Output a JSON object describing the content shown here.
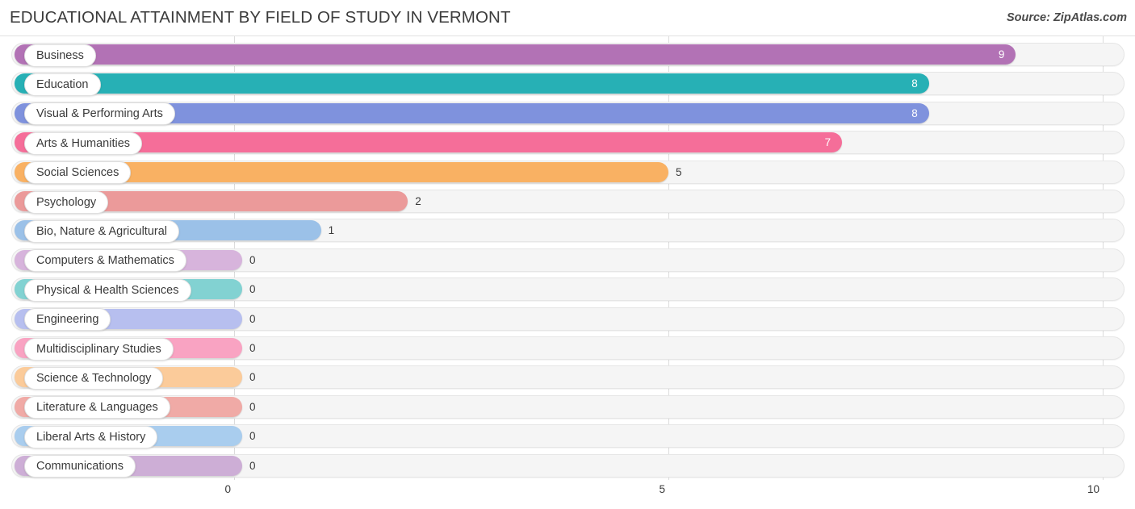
{
  "header": {
    "title": "EDUCATIONAL ATTAINMENT BY FIELD OF STUDY IN VERMONT",
    "source": "Source: ZipAtlas.com"
  },
  "chart_data": {
    "type": "bar",
    "orientation": "horizontal",
    "title": "EDUCATIONAL ATTAINMENT BY FIELD OF STUDY IN VERMONT",
    "xlabel": "",
    "ylabel": "",
    "xlim": [
      0,
      10
    ],
    "grid": true,
    "legend": "none",
    "xticks": [
      "0",
      "5",
      "10"
    ],
    "xtick_values": [
      0,
      5,
      10
    ],
    "categories": [
      "Business",
      "Education",
      "Visual & Performing Arts",
      "Arts & Humanities",
      "Social Sciences",
      "Psychology",
      "Bio, Nature & Agricultural",
      "Computers & Mathematics",
      "Physical & Health Sciences",
      "Engineering",
      "Multidisciplinary Studies",
      "Science & Technology",
      "Literature & Languages",
      "Liberal Arts & History",
      "Communications"
    ],
    "values": [
      9,
      8,
      8,
      7,
      5,
      2,
      1,
      0,
      0,
      0,
      0,
      0,
      0,
      0,
      0
    ],
    "value_labels": [
      "9",
      "8",
      "8",
      "7",
      "5",
      "2",
      "1",
      "0",
      "0",
      "0",
      "0",
      "0",
      "0",
      "0",
      "0"
    ],
    "colors": [
      "#b272b5",
      "#27b0b5",
      "#7f92dd",
      "#f56e99",
      "#f9b163",
      "#eb9a9a",
      "#9bc1e8",
      "#d7b4dc",
      "#82d2d2",
      "#b7bfef",
      "#f9a3c2",
      "#fbcb9a",
      "#f0aaa6",
      "#a9cdee",
      "#cdaed6"
    ]
  },
  "rows": [
    {
      "label": "Business",
      "value": "9",
      "value_num": 9,
      "color": "#b272b5",
      "inside": true
    },
    {
      "label": "Education",
      "value": "8",
      "value_num": 8,
      "color": "#27b0b5",
      "inside": true
    },
    {
      "label": "Visual & Performing Arts",
      "value": "8",
      "value_num": 8,
      "color": "#7f92dd",
      "inside": true
    },
    {
      "label": "Arts & Humanities",
      "value": "7",
      "value_num": 7,
      "color": "#f56e99",
      "inside": true
    },
    {
      "label": "Social Sciences",
      "value": "5",
      "value_num": 5,
      "color": "#f9b163",
      "inside": false
    },
    {
      "label": "Psychology",
      "value": "2",
      "value_num": 2,
      "color": "#eb9a9a",
      "inside": false
    },
    {
      "label": "Bio, Nature & Agricultural",
      "value": "1",
      "value_num": 1,
      "color": "#9bc1e8",
      "inside": false
    },
    {
      "label": "Computers & Mathematics",
      "value": "0",
      "value_num": 0,
      "color": "#d7b4dc",
      "inside": false
    },
    {
      "label": "Physical & Health Sciences",
      "value": "0",
      "value_num": 0,
      "color": "#82d2d2",
      "inside": false
    },
    {
      "label": "Engineering",
      "value": "0",
      "value_num": 0,
      "color": "#b7bfef",
      "inside": false
    },
    {
      "label": "Multidisciplinary Studies",
      "value": "0",
      "value_num": 0,
      "color": "#f9a3c2",
      "inside": false
    },
    {
      "label": "Science & Technology",
      "value": "0",
      "value_num": 0,
      "color": "#fbcb9a",
      "inside": false
    },
    {
      "label": "Literature & Languages",
      "value": "0",
      "value_num": 0,
      "color": "#f0aaa6",
      "inside": false
    },
    {
      "label": "Liberal Arts & History",
      "value": "0",
      "value_num": 0,
      "color": "#a9cdee",
      "inside": false
    },
    {
      "label": "Communications",
      "value": "0",
      "value_num": 0,
      "color": "#cdaed6",
      "inside": false
    }
  ],
  "axis": {
    "ticks": [
      {
        "label": "0",
        "value": 0
      },
      {
        "label": "5",
        "value": 5
      },
      {
        "label": "10",
        "value": 10
      }
    ]
  }
}
